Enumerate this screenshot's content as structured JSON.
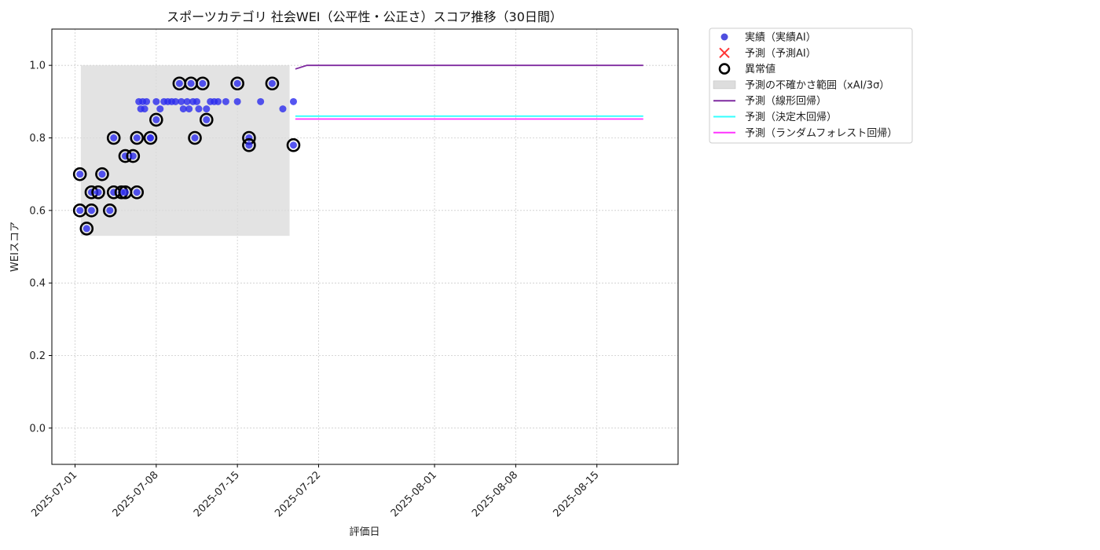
{
  "chart_data": {
    "type": "scatter",
    "title": "スポーツカテゴリ 社会WEI（公平性・公正さ）スコア推移（30日間）",
    "xlabel": "評価日",
    "ylabel": "WEIスコア",
    "ylim": [
      -0.1,
      1.1
    ],
    "xlim": [
      "2025-06-29",
      "2025-08-22"
    ],
    "grid": true,
    "legend_position": "outside-top-right",
    "x_ticks": [
      "2025-07-01",
      "2025-07-08",
      "2025-07-15",
      "2025-07-22",
      "2025-08-01",
      "2025-08-08",
      "2025-08-15"
    ],
    "y_ticks": [
      "0.0",
      "0.2",
      "0.4",
      "0.6",
      "0.8",
      "1.0"
    ],
    "y_tick_values": [
      0.0,
      0.2,
      0.4,
      0.6,
      0.8,
      1.0
    ],
    "legend": [
      {
        "label": "実績（実績AI）",
        "marker": "dot",
        "color": "#3b3bdb"
      },
      {
        "label": "予測（予測AI）",
        "marker": "x",
        "color": "#ff3333"
      },
      {
        "label": "異常値",
        "marker": "ring",
        "color": "#000000"
      },
      {
        "label": "予測の不確かさ範囲（xAI/3σ）",
        "marker": "band",
        "color": "#dddddd"
      },
      {
        "label": "予測（線形回帰）",
        "marker": "line",
        "color": "#7f2aa0"
      },
      {
        "label": "予測（決定木回帰）",
        "marker": "line",
        "color": "#33ffff"
      },
      {
        "label": "予測（ランダムフォレスト回帰）",
        "marker": "line",
        "color": "#ff33ff"
      }
    ],
    "uncertainty_band": {
      "x_start": "2025-07-01 12:00",
      "x_end": "2025-07-19 12:00",
      "y_low": 0.53,
      "y_high": 1.0,
      "color": "#d9d9d9"
    },
    "series": [
      {
        "name": "実績（実績AI）",
        "color": "#2a2aee",
        "points": [
          {
            "x": "2025-07-01 10:00",
            "y": 0.7,
            "outlier": true
          },
          {
            "x": "2025-07-01 10:00",
            "y": 0.6,
            "outlier": true
          },
          {
            "x": "2025-07-02 00:00",
            "y": 0.55,
            "outlier": true
          },
          {
            "x": "2025-07-02 10:00",
            "y": 0.65,
            "outlier": true
          },
          {
            "x": "2025-07-02 10:00",
            "y": 0.6,
            "outlier": true
          },
          {
            "x": "2025-07-03 00:00",
            "y": 0.65,
            "outlier": true
          },
          {
            "x": "2025-07-03 08:00",
            "y": 0.7,
            "outlier": true
          },
          {
            "x": "2025-07-04 00:00",
            "y": 0.6,
            "outlier": true
          },
          {
            "x": "2025-07-04 08:00",
            "y": 0.8,
            "outlier": true
          },
          {
            "x": "2025-07-04 08:00",
            "y": 0.65,
            "outlier": true
          },
          {
            "x": "2025-07-05 00:00",
            "y": 0.65,
            "outlier": true
          },
          {
            "x": "2025-07-05 08:00",
            "y": 0.75,
            "outlier": true
          },
          {
            "x": "2025-07-05 08:00",
            "y": 0.65,
            "outlier": true
          },
          {
            "x": "2025-07-06 00:00",
            "y": 0.75,
            "outlier": true
          },
          {
            "x": "2025-07-06 08:00",
            "y": 0.8,
            "outlier": true
          },
          {
            "x": "2025-07-06 08:00",
            "y": 0.65,
            "outlier": true
          },
          {
            "x": "2025-07-06 12:00",
            "y": 0.9,
            "outlier": false
          },
          {
            "x": "2025-07-06 16:00",
            "y": 0.88,
            "outlier": false
          },
          {
            "x": "2025-07-06 20:00",
            "y": 0.9,
            "outlier": false
          },
          {
            "x": "2025-07-07 00:00",
            "y": 0.88,
            "outlier": false
          },
          {
            "x": "2025-07-07 04:00",
            "y": 0.9,
            "outlier": false
          },
          {
            "x": "2025-07-07 12:00",
            "y": 0.8,
            "outlier": true
          },
          {
            "x": "2025-07-07 12:00",
            "y": 0.8,
            "outlier": false
          },
          {
            "x": "2025-07-08 00:00",
            "y": 0.85,
            "outlier": true
          },
          {
            "x": "2025-07-08 00:00",
            "y": 0.9,
            "outlier": false
          },
          {
            "x": "2025-07-08 08:00",
            "y": 0.88,
            "outlier": false
          },
          {
            "x": "2025-07-08 16:00",
            "y": 0.9,
            "outlier": false
          },
          {
            "x": "2025-07-09 00:00",
            "y": 0.9,
            "outlier": false
          },
          {
            "x": "2025-07-09 08:00",
            "y": 0.9,
            "outlier": false
          },
          {
            "x": "2025-07-09 16:00",
            "y": 0.9,
            "outlier": false
          },
          {
            "x": "2025-07-10 00:00",
            "y": 0.95,
            "outlier": true
          },
          {
            "x": "2025-07-10 04:00",
            "y": 0.9,
            "outlier": false
          },
          {
            "x": "2025-07-10 08:00",
            "y": 0.88,
            "outlier": false
          },
          {
            "x": "2025-07-10 16:00",
            "y": 0.9,
            "outlier": false
          },
          {
            "x": "2025-07-10 20:00",
            "y": 0.88,
            "outlier": false
          },
          {
            "x": "2025-07-11 00:00",
            "y": 0.95,
            "outlier": true
          },
          {
            "x": "2025-07-11 04:00",
            "y": 0.9,
            "outlier": false
          },
          {
            "x": "2025-07-11 08:00",
            "y": 0.8,
            "outlier": true
          },
          {
            "x": "2025-07-11 12:00",
            "y": 0.9,
            "outlier": false
          },
          {
            "x": "2025-07-11 16:00",
            "y": 0.88,
            "outlier": false
          },
          {
            "x": "2025-07-12 00:00",
            "y": 0.95,
            "outlier": true
          },
          {
            "x": "2025-07-12 08:00",
            "y": 0.85,
            "outlier": true
          },
          {
            "x": "2025-07-12 08:00",
            "y": 0.88,
            "outlier": false
          },
          {
            "x": "2025-07-12 16:00",
            "y": 0.9,
            "outlier": false
          },
          {
            "x": "2025-07-13 00:00",
            "y": 0.9,
            "outlier": false
          },
          {
            "x": "2025-07-13 08:00",
            "y": 0.9,
            "outlier": false
          },
          {
            "x": "2025-07-14 00:00",
            "y": 0.9,
            "outlier": false
          },
          {
            "x": "2025-07-15 00:00",
            "y": 0.95,
            "outlier": true
          },
          {
            "x": "2025-07-15 00:00",
            "y": 0.9,
            "outlier": false
          },
          {
            "x": "2025-07-16 00:00",
            "y": 0.8,
            "outlier": true
          },
          {
            "x": "2025-07-16 00:00",
            "y": 0.78,
            "outlier": true
          },
          {
            "x": "2025-07-17 00:00",
            "y": 0.9,
            "outlier": false
          },
          {
            "x": "2025-07-18 00:00",
            "y": 0.95,
            "outlier": true
          },
          {
            "x": "2025-07-18 22:00",
            "y": 0.88,
            "outlier": false
          },
          {
            "x": "2025-07-19 20:00",
            "y": 0.9,
            "outlier": false
          },
          {
            "x": "2025-07-19 20:00",
            "y": 0.78,
            "outlier": true
          }
        ]
      },
      {
        "name": "予測（線形回帰）",
        "color": "#7f2aa0",
        "line": [
          {
            "x": "2025-07-20 00:00",
            "y": 0.99
          },
          {
            "x": "2025-07-21 00:00",
            "y": 1.0
          },
          {
            "x": "2025-08-19 00:00",
            "y": 1.0
          }
        ]
      },
      {
        "name": "予測（決定木回帰）",
        "color": "#33ffff",
        "line": [
          {
            "x": "2025-07-20 00:00",
            "y": 0.86
          },
          {
            "x": "2025-08-19 00:00",
            "y": 0.86
          }
        ]
      },
      {
        "name": "予測（ランダムフォレスト回帰）",
        "color": "#ff33ff",
        "line": [
          {
            "x": "2025-07-20 00:00",
            "y": 0.852
          },
          {
            "x": "2025-08-19 00:00",
            "y": 0.852
          }
        ]
      }
    ]
  }
}
